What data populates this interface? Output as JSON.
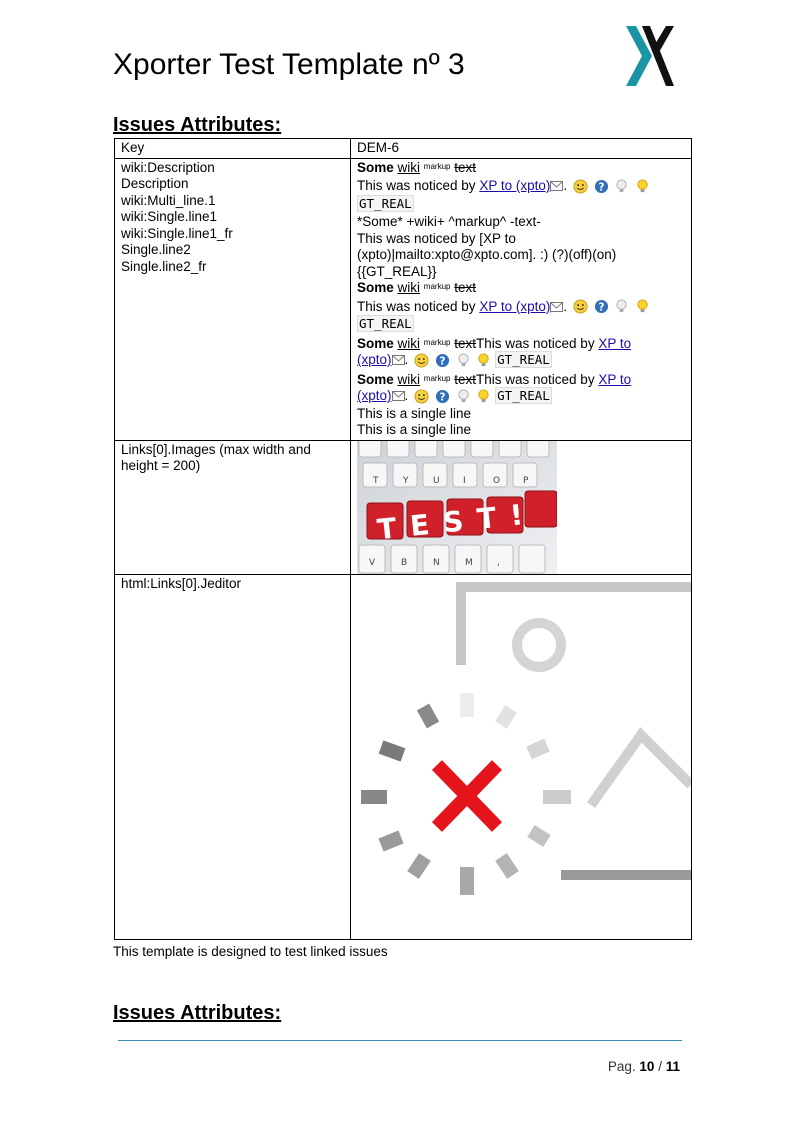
{
  "document": {
    "title": "Xporter Test Template nº 3",
    "section_heading": "Issues Attributes:",
    "section_heading_2": "Issues Attributes:",
    "footnote": "This template is designed to test linked issues"
  },
  "logo": {
    "icon": "xporter-x-logo",
    "colors": {
      "teal": "#1b95a6",
      "dark": "#111111"
    }
  },
  "table": {
    "header": {
      "key": "Key",
      "value": "DEM-6"
    },
    "row1_keys": [
      "wiki:Description",
      "Description",
      "wiki:Multi_line.1",
      "wiki:Single.line1",
      "wiki:Single.line1_fr",
      "Single.line2",
      "Single.line2_fr"
    ],
    "wiki": {
      "some": "Some",
      "wiki": "wiki",
      "markup": "markup",
      "text": "text",
      "noticed": "This was noticed by ",
      "link": "XP to (xpto)",
      "gt": "GT_REAL",
      "raw1": "*Some* +wiki+ ^markup^  -text-",
      "raw2": "This was noticed by [XP to (xpto)|mailto:xpto@xpto.com]. :) (?)(off)(on)",
      "raw3": "{{GT_REAL}}",
      "single": "This is a single line",
      "link_a": "XP to",
      "link_b": "(xpto)"
    },
    "row2_key": "Links[0].Images (max width and height = 200)",
    "row3_key": "html:Links[0].Jeditor",
    "keyboard_keys_text": "TEST!"
  },
  "footer": {
    "page_label": "Pag.",
    "current": "10",
    "sep": " / ",
    "total": "11"
  },
  "colors": {
    "link": "#1a0dab",
    "footer_rule": "#3a8fb7",
    "key_red": "#d0202a",
    "error_red": "#e5141b"
  }
}
